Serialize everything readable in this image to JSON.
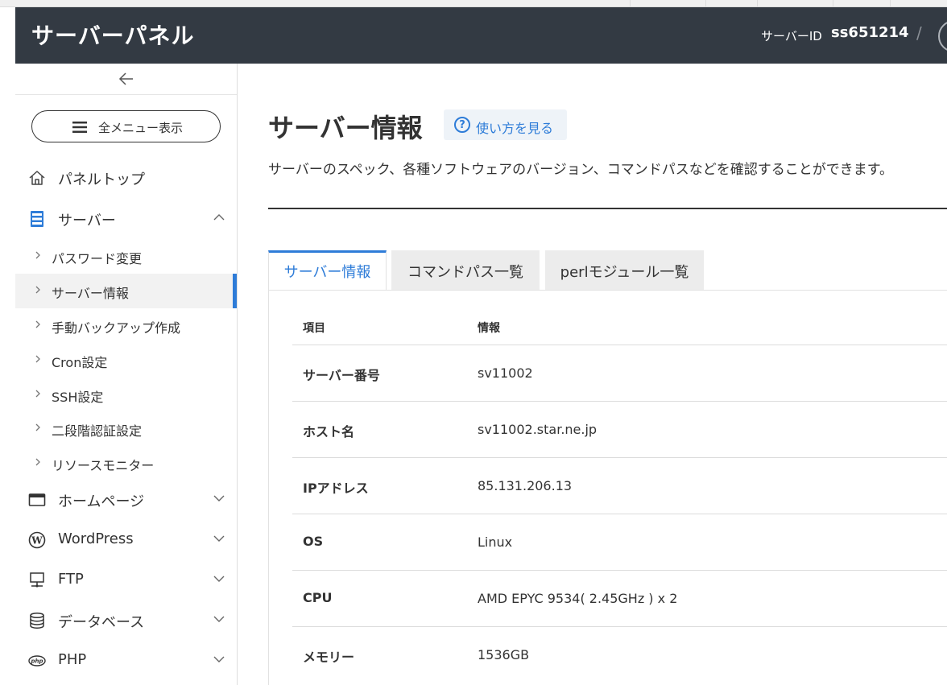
{
  "header": {
    "brand": "サーバーパネル",
    "server_id_label": "サーバーID",
    "server_id": "ss651214",
    "separator": "/"
  },
  "sidebar": {
    "collapse_icon": "arrow-left-icon",
    "menu_button_label": "全メニュー表示",
    "main_items": [
      {
        "label": "パネルトップ",
        "icon": "home-icon"
      },
      {
        "label": "サーバー",
        "icon": "server-icon",
        "expanded": true
      },
      {
        "label": "ホームページ",
        "icon": "browser-window-icon"
      },
      {
        "label": "WordPress",
        "icon": "wordpress-icon"
      },
      {
        "label": "FTP",
        "icon": "ftp-icon"
      },
      {
        "label": "データベース",
        "icon": "database-icon"
      },
      {
        "label": "PHP",
        "icon": "php-icon"
      }
    ],
    "sub_items": [
      {
        "label": "パスワード変更"
      },
      {
        "label": "サーバー情報",
        "active": true
      },
      {
        "label": "手動バックアップ作成"
      },
      {
        "label": "Cron設定"
      },
      {
        "label": "SSH設定"
      },
      {
        "label": "二段階認証設定"
      },
      {
        "label": "リソースモニター"
      }
    ]
  },
  "main": {
    "title": "サーバー情報",
    "howto_label": "使い方を見る",
    "help_glyph": "?",
    "description": "サーバーのスペック、各種ソフトウェアのバージョン、コマンドパスなどを確認することができます。",
    "tabs": [
      {
        "label": "サーバー情報",
        "active": true
      },
      {
        "label": "コマンドパス一覧"
      },
      {
        "label": "perlモジュール一覧"
      }
    ],
    "table": {
      "headers": [
        "項目",
        "情報"
      ],
      "rows": [
        {
          "key": "サーバー番号",
          "value": "sv11002"
        },
        {
          "key": "ホスト名",
          "value": "sv11002.star.ne.jp"
        },
        {
          "key": "IPアドレス",
          "value": "85.131.206.13"
        },
        {
          "key": "OS",
          "value": "Linux"
        },
        {
          "key": "CPU",
          "value": "AMD EPYC 9534( 2.45GHz ) x 2"
        },
        {
          "key": "メモリー",
          "value": "1536GB"
        }
      ]
    }
  },
  "colors": {
    "header_bg": "#333a43",
    "accent": "#2e7cd8",
    "text": "#333333"
  }
}
